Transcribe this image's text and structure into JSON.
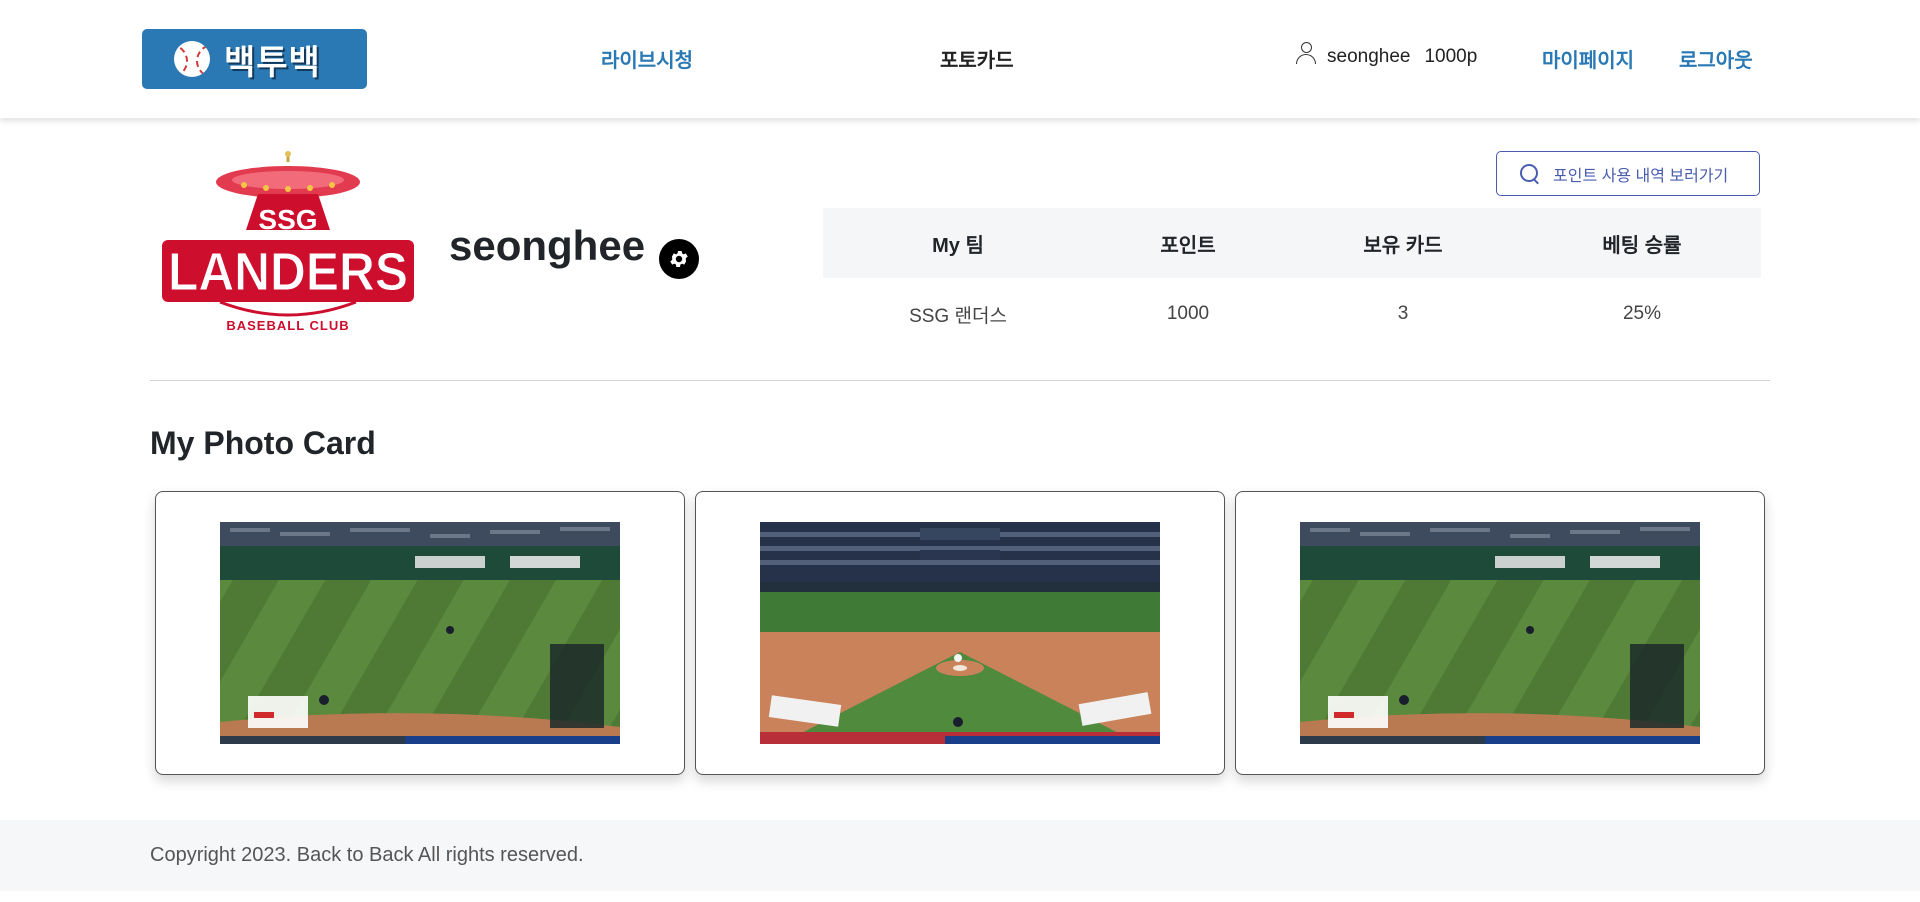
{
  "header": {
    "logo_text": "백투백",
    "nav": {
      "live": "라이브시청",
      "photocard": "포토카드"
    },
    "user": {
      "name": "seonghee",
      "points": "1000p"
    },
    "mypage": "마이페이지",
    "logout": "로그아웃"
  },
  "profile": {
    "team_logo": {
      "top_text": "SSG",
      "main_text": "LANDERS",
      "sub_text": "BASEBALL CLUB"
    },
    "username": "seonghee",
    "points_history_button": "포인트 사용 내역 보러가기",
    "stats": {
      "headers": [
        "My 팀",
        "포인트",
        "보유 카드",
        "베팅 승률"
      ],
      "values": [
        "SSG 랜더스",
        "1000",
        "3",
        "25%"
      ]
    }
  },
  "photo_cards": {
    "title": "My Photo Card",
    "cards": [
      {
        "scene": "outfield"
      },
      {
        "scene": "infield"
      },
      {
        "scene": "outfield"
      }
    ]
  },
  "footer": {
    "copyright": "Copyright 2023. Back to Back All rights reserved."
  },
  "colors": {
    "brand_blue": "#2a78b4",
    "ssg_red": "#ce0e2d",
    "outline_button": "#4a5cb0"
  }
}
